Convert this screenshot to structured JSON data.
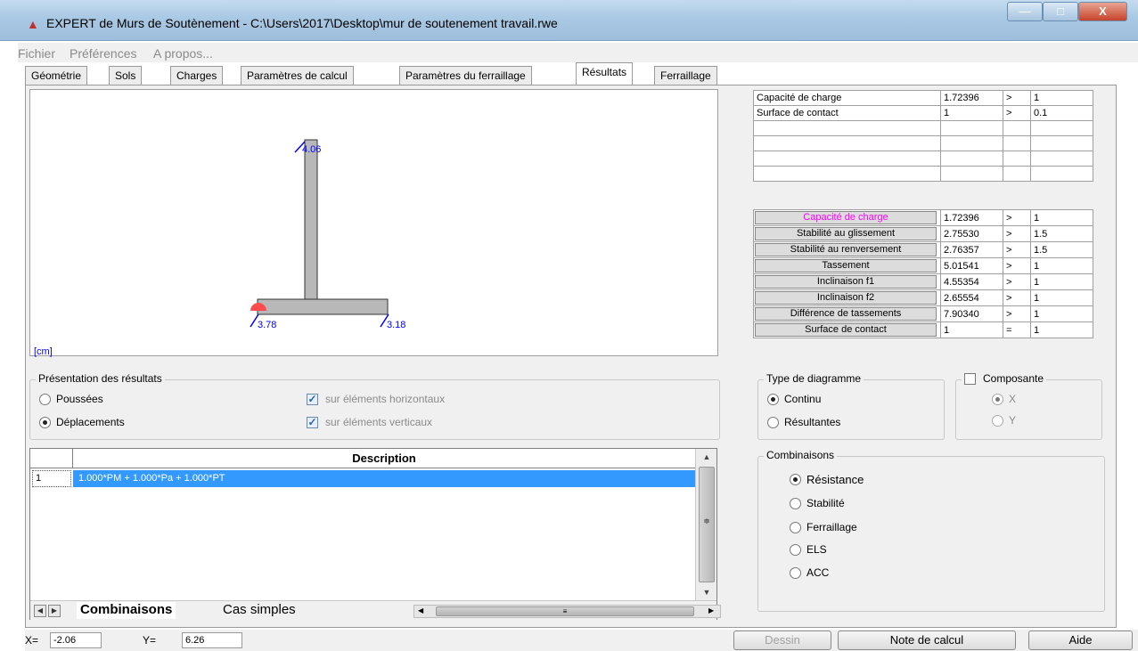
{
  "window": {
    "title": "EXPERT de Murs de Soutènement - C:\\Users\\2017\\Desktop\\mur de soutenement travail.rwe",
    "minimize_glyph": "—",
    "maximize_glyph": "□",
    "close_glyph": "X"
  },
  "menu": {
    "items": [
      "Fichier",
      "Préférences",
      "A propos..."
    ]
  },
  "tabs": [
    "Géométrie",
    "Sols",
    "Charges",
    "Paramètres de calcul",
    "Paramètres du ferraillage",
    "Résultats",
    "Ferraillage"
  ],
  "active_tab": "Résultats",
  "drawing": {
    "unit_label": "[cm]",
    "labels": {
      "top": "4.06",
      "bottom_left": "3.78",
      "bottom_right": "3.18"
    }
  },
  "summary_table": [
    {
      "label": "Capacité de charge",
      "value": "1.72396",
      "op": ">",
      "limit": "1"
    },
    {
      "label": "Surface de contact",
      "value": "1",
      "op": ">",
      "limit": "0.1"
    },
    {
      "label": "",
      "value": "",
      "op": "",
      "limit": ""
    },
    {
      "label": "",
      "value": "",
      "op": "",
      "limit": ""
    },
    {
      "label": "",
      "value": "",
      "op": "",
      "limit": ""
    },
    {
      "label": "",
      "value": "",
      "op": "",
      "limit": ""
    }
  ],
  "checks_table": [
    {
      "label": "Capacité de charge",
      "value": "1.72396",
      "op": ">",
      "limit": "1"
    },
    {
      "label": "Stabilité au glissement",
      "value": "2.75530",
      "op": ">",
      "limit": "1.5"
    },
    {
      "label": "Stabilité au renversement",
      "value": "2.76357",
      "op": ">",
      "limit": "1.5"
    },
    {
      "label": "Tassement",
      "value": "5.01541",
      "op": ">",
      "limit": "1"
    },
    {
      "label": "Inclinaison f1",
      "value": "4.55354",
      "op": ">",
      "limit": "1"
    },
    {
      "label": "Inclinaison f2",
      "value": "2.65554",
      "op": ">",
      "limit": "1"
    },
    {
      "label": "Différence de tassements",
      "value": "7.90340",
      "op": ">",
      "limit": "1"
    },
    {
      "label": "Surface de contact",
      "value": "1",
      "op": "=",
      "limit": "1"
    }
  ],
  "presentation": {
    "title": "Présentation des résultats",
    "options": [
      "Poussées",
      "Déplacements"
    ],
    "selected": "Déplacements",
    "checkboxes": [
      "sur éléments horizontaux",
      "sur éléments verticaux"
    ]
  },
  "diagram_type": {
    "title": "Type de diagramme",
    "options": [
      "Continu",
      "Résultantes"
    ],
    "selected": "Continu"
  },
  "composante": {
    "title": "Composante",
    "options": [
      "X",
      "Y"
    ],
    "selected": "X"
  },
  "combinaisons_group": {
    "title": "Combinaisons",
    "options": [
      "Résistance",
      "Stabilité",
      "Ferraillage",
      "ELS",
      "ACC"
    ],
    "selected": "Résistance"
  },
  "list": {
    "header": "Description",
    "rows": [
      {
        "num": "1",
        "desc": "1.000*PM + 1.000*Pa + 1.000*PT"
      }
    ],
    "sheet_tabs": [
      "Combinaisons",
      "Cas simples"
    ],
    "up_glyph": "▲",
    "down_glyph": "▼",
    "grip_glyph": "≑",
    "nav_left": "◀",
    "nav_right": "▶",
    "hs_left": "◀",
    "hs_right": "▶",
    "hs_grip": "≡"
  },
  "status": {
    "x_label": "X=",
    "x_value": "-2.06",
    "y_label": "Y=",
    "y_value": "6.26",
    "buttons": {
      "dessin": "Dessin",
      "note": "Note de calcul",
      "aide": "Aide"
    }
  }
}
